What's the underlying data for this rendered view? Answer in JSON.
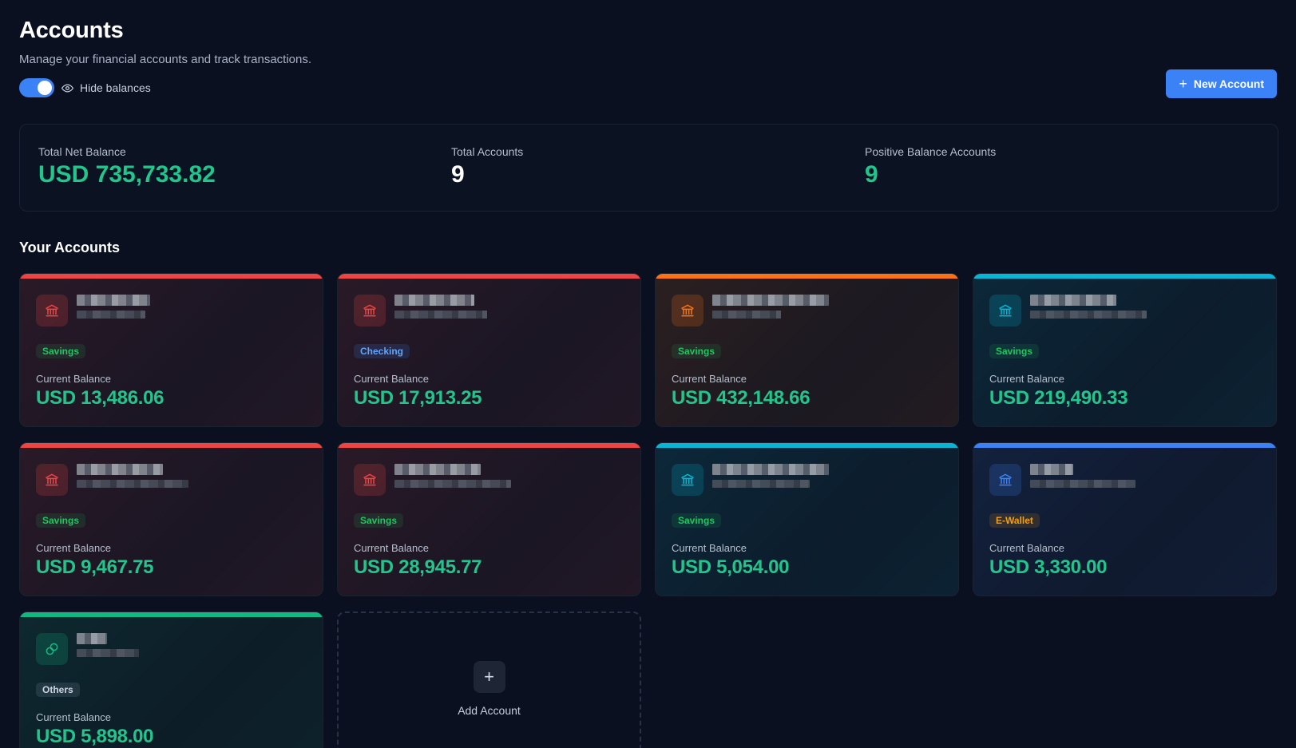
{
  "header": {
    "title": "Accounts",
    "subtitle": "Manage your financial accounts and track transactions.",
    "hide_balances_label": "Hide balances",
    "hide_balances_on": true,
    "new_account_label": "New Account"
  },
  "summary": {
    "net_label": "Total Net Balance",
    "net_value": "USD 735,733.82",
    "total_label": "Total Accounts",
    "total_value": "9",
    "positive_label": "Positive Balance Accounts",
    "positive_value": "9"
  },
  "section_title": "Your Accounts",
  "balance_label": "Current Balance",
  "icons": {
    "bank": "bank-icon",
    "eye": "eye-icon",
    "plus": "plus-icon",
    "link": "link-icon"
  },
  "accounts": [
    {
      "type": "Savings",
      "balance": "USD 13,486.06",
      "accent": "#ef4444",
      "icon": "bank-icon"
    },
    {
      "type": "Checking",
      "balance": "USD 17,913.25",
      "accent": "#ef4444",
      "icon": "bank-icon"
    },
    {
      "type": "Savings",
      "balance": "USD 432,148.66",
      "accent": "#f97316",
      "icon": "bank-icon"
    },
    {
      "type": "Savings",
      "balance": "USD 219,490.33",
      "accent": "#06b6d4",
      "icon": "bank-icon"
    },
    {
      "type": "Savings",
      "balance": "USD 9,467.75",
      "accent": "#ef4444",
      "icon": "bank-icon"
    },
    {
      "type": "Savings",
      "balance": "USD 28,945.77",
      "accent": "#ef4444",
      "icon": "bank-icon"
    },
    {
      "type": "Savings",
      "balance": "USD 5,054.00",
      "accent": "#06b6d4",
      "icon": "bank-icon"
    },
    {
      "type": "E-Wallet",
      "balance": "USD 3,330.00",
      "accent": "#3b82f6",
      "icon": "bank-icon"
    },
    {
      "type": "Others",
      "balance": "USD 5,898.00",
      "accent": "#10b981",
      "icon": "link-icon"
    }
  ],
  "add_account_label": "Add Account",
  "colors": {
    "background": "#0a1020",
    "primary": "#3b82f6",
    "positive": "#22c58b",
    "savings_badge": "#22c55e",
    "checking_badge": "#60a5fa",
    "ewallet_badge": "#f59e0b",
    "others_badge": "#cbd5e1"
  }
}
